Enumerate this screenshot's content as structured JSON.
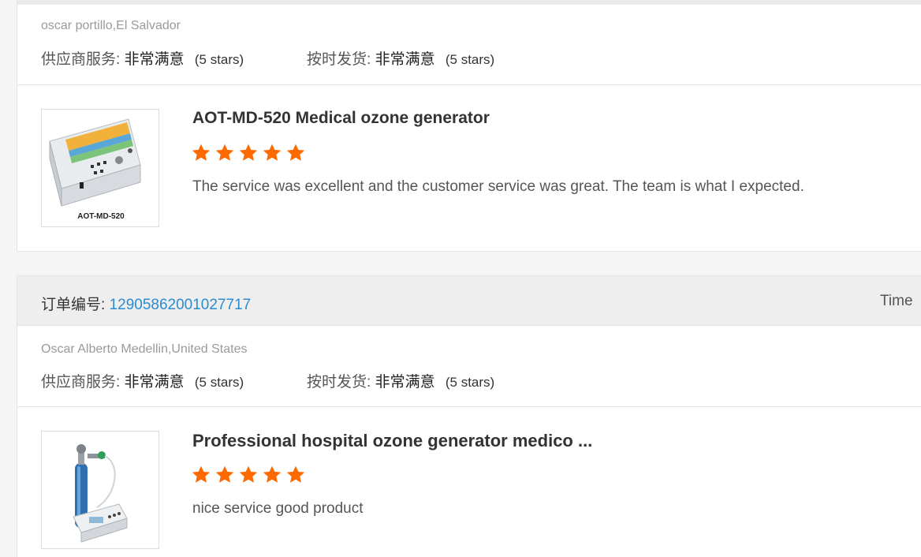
{
  "reviews": [
    {
      "buyer": "oscar portillo,El Salvador",
      "supplier_service_label": "供应商服务:",
      "supplier_service_value": "非常满意",
      "supplier_service_stars": "(5 stars)",
      "on_time_label": "按时发货:",
      "on_time_value": "非常满意",
      "on_time_stars": "(5 stars)",
      "product_title": "AOT-MD-520 Medical ozone generator",
      "product_image_caption": "AOT-MD-520",
      "rating": 5,
      "review_text": "The service was excellent and the customer service was great. The team is what I expected."
    },
    {
      "order_label": "订单编号:",
      "order_number": "12905862001027717",
      "time_label": "Time",
      "buyer": "Oscar Alberto Medellin,United States",
      "supplier_service_label": "供应商服务:",
      "supplier_service_value": "非常满意",
      "supplier_service_stars": "(5 stars)",
      "on_time_label": "按时发货:",
      "on_time_value": "非常满意",
      "on_time_stars": "(5 stars)",
      "product_title": "Professional hospital ozone generator medico ...",
      "rating": 5,
      "review_text": "nice service good product"
    }
  ],
  "colors": {
    "star": "#ff6a00",
    "order_number": "#2a8ccf"
  }
}
